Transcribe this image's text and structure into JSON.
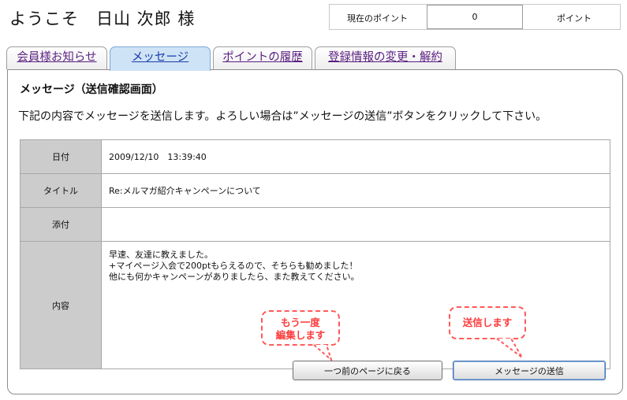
{
  "header": {
    "welcome": "ようこそ　日山 次郎 様",
    "points_label": "現在のポイント",
    "points_value": "0",
    "points_unit": "ポイント"
  },
  "tabs": [
    {
      "label": "会員様お知らせ",
      "active": false
    },
    {
      "label": "メッセージ",
      "active": true
    },
    {
      "label": "ポイントの履歴",
      "active": false
    },
    {
      "label": "登録情報の変更・解約",
      "active": false
    }
  ],
  "panel": {
    "title": "メッセージ（送信確認画面）",
    "instruction": "下記の内容でメッセージを送信します。よろしい場合は”メッセージの送信”ボタンをクリックして下さい。"
  },
  "details": {
    "date_label": "日付",
    "date_value": "2009/12/10　13:39:40",
    "title_label": "タイトル",
    "title_value": "Re:メルマガ紹介キャンペーンについて",
    "attach_label": "添付",
    "attach_value": "",
    "content_label": "内容",
    "content_lines": [
      "早速、友達に教えました。",
      "+マイページ入会で200ptもらえるので、そちらも勧めました！",
      "他にも何かキャンペーンがありましたら、また教えてください。"
    ]
  },
  "buttons": {
    "back": "一つ前のページに戻る",
    "send": "メッセージの送信"
  },
  "callouts": {
    "edit_line1": "もう一度",
    "edit_line2": "編集します",
    "send": "送信します"
  },
  "colors": {
    "active_tab": "#cfe3f7",
    "label_cell": "#cccccc",
    "callout": "#ff3a3a",
    "tab_link": "#5a1f80"
  }
}
